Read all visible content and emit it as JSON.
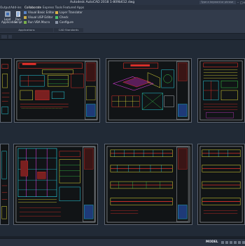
{
  "titlebar": {
    "title": "Autodesk AutoCAD 2018   1-809b612.dwg",
    "search_placeholder": "Type a keyword or phrase"
  },
  "tabs": [
    {
      "label": "Output"
    },
    {
      "label": "Add-ins"
    },
    {
      "label": "Collaborate"
    },
    {
      "label": "Express Tools"
    },
    {
      "label": "Featured Apps"
    }
  ],
  "ribbon": {
    "load_application": "Load Application",
    "run_script": "Run Script",
    "visual_basic_editor": "Visual Basic Editor",
    "visual_lisp_editor": "Visual LISP Editor",
    "run_vba_macro": "Run VBA Macro",
    "layer_translator": "Layer Translator",
    "check": "Check",
    "configure": "Configure",
    "applications_panel": "Applications",
    "cad_standards_panel": "CAD Standards"
  },
  "status": {
    "model": "MODEL"
  },
  "colors": {
    "background": "#212a36",
    "sheet": "#111416",
    "red": "#e0302a",
    "yellow": "#e8e23a",
    "cyan": "#28d8e8",
    "green": "#39d04a",
    "magenta": "#d43ad8",
    "white": "#e6e6e6"
  },
  "icons": [
    "load-application-icon",
    "run-script-icon",
    "visual-basic-icon",
    "visual-lisp-icon",
    "run-vba-icon",
    "layer-translator-icon",
    "check-icon",
    "configure-icon"
  ]
}
